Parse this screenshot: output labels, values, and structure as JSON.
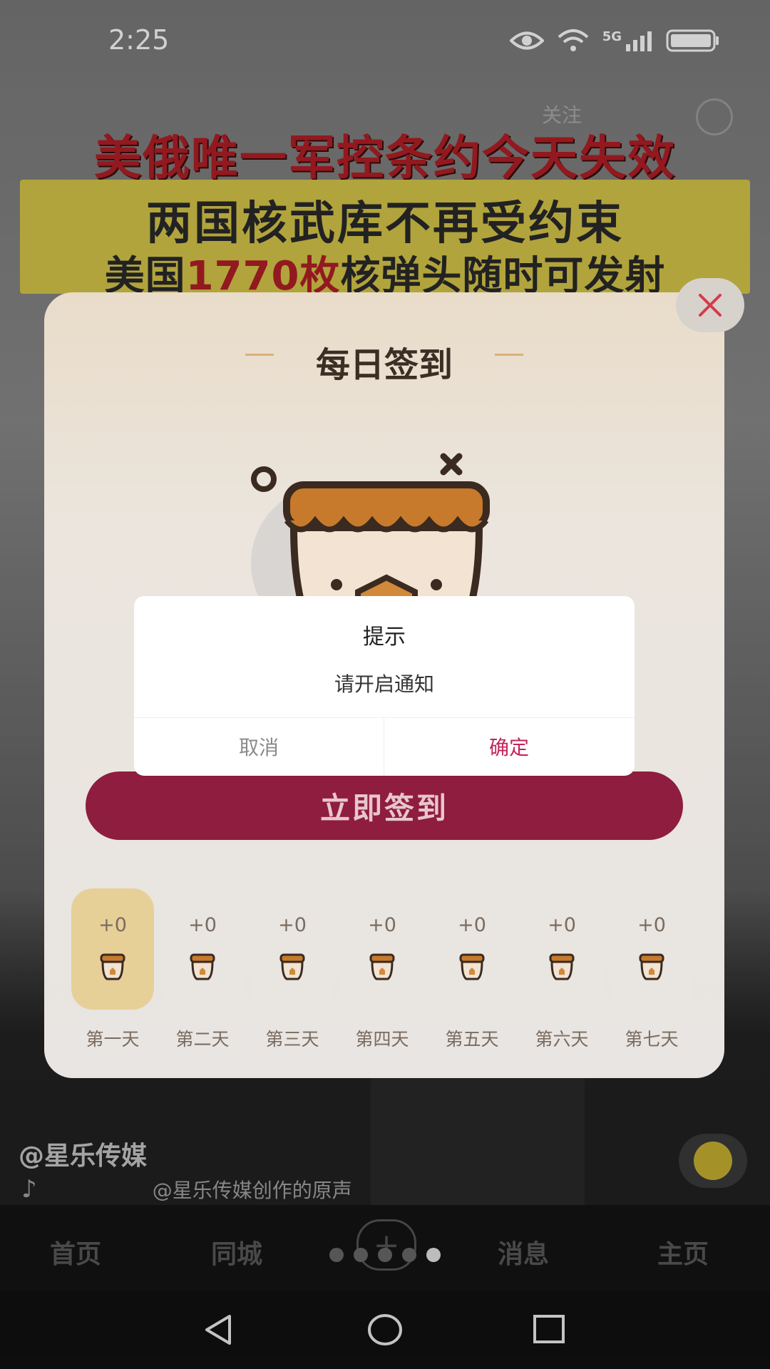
{
  "status_bar": {
    "time": "2:25",
    "network": "5G"
  },
  "video": {
    "headline_red": "美俄唯一军控条约今天失效",
    "headline_line2": "两国核武库不再受约束",
    "headline_line3_prefix": "美国",
    "headline_line3_highlight": "1770枚",
    "headline_line3_suffix": "核弹头随时可发射",
    "follow_label": "关注",
    "author": "@星乐传媒",
    "music_title": "@星乐传媒创作的原声"
  },
  "checkin": {
    "title": "每日签到",
    "button_label": "立即签到",
    "days": [
      {
        "points": "+0",
        "label": "第一天",
        "active": true
      },
      {
        "points": "+0",
        "label": "第二天",
        "active": false
      },
      {
        "points": "+0",
        "label": "第三天",
        "active": false
      },
      {
        "points": "+0",
        "label": "第四天",
        "active": false
      },
      {
        "points": "+0",
        "label": "第五天",
        "active": false
      },
      {
        "points": "+0",
        "label": "第六天",
        "active": false
      },
      {
        "points": "+0",
        "label": "第七天",
        "active": false
      }
    ]
  },
  "dialog": {
    "title": "提示",
    "message": "请开启通知",
    "cancel_label": "取消",
    "confirm_label": "确定"
  },
  "bottom_nav": {
    "home": "首页",
    "local": "同城",
    "messages": "消息",
    "profile": "主页",
    "active_page_dot": 5,
    "page_dot_count": 5
  },
  "colors": {
    "checkin_button": "#8e1d3f",
    "confirm_text": "#c2255c",
    "headline_red": "#b21f26",
    "headline_box": "#d8c84a"
  }
}
